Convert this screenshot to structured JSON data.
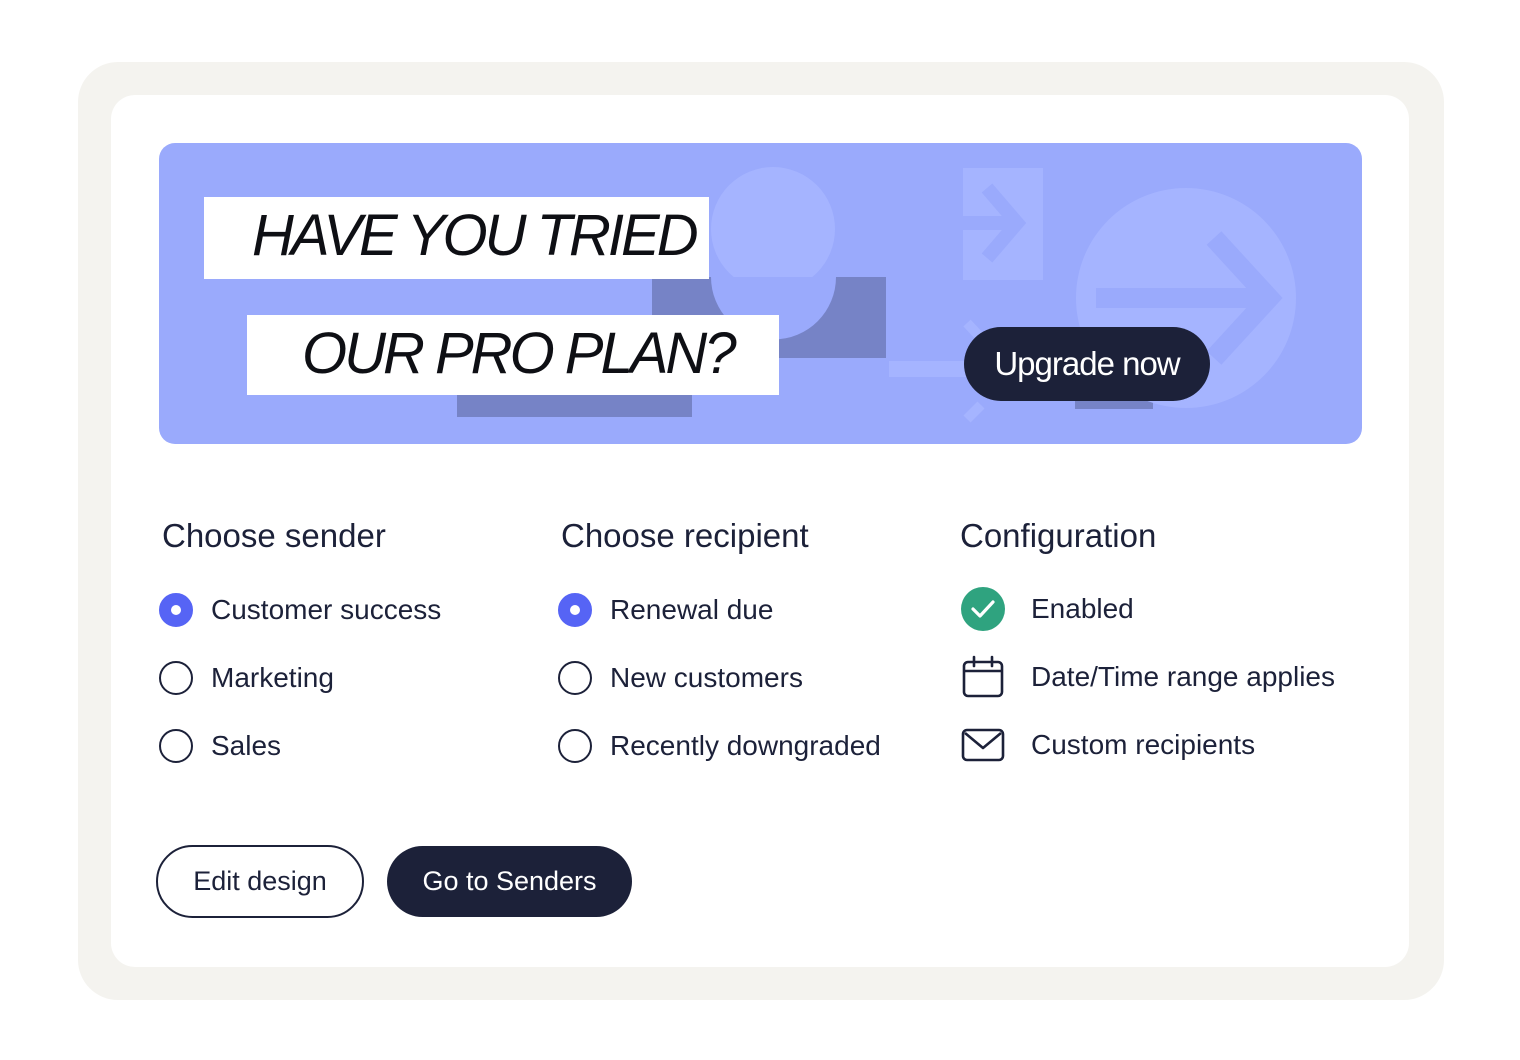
{
  "banner": {
    "headline_line1": "HAVE YOU TRIED",
    "headline_line2": "OUR PRO PLAN?",
    "cta_label": "Upgrade now"
  },
  "sender": {
    "heading": "Choose sender",
    "options": [
      {
        "label": "Customer success",
        "selected": true
      },
      {
        "label": "Marketing",
        "selected": false
      },
      {
        "label": "Sales",
        "selected": false
      }
    ]
  },
  "recipient": {
    "heading": "Choose recipient",
    "options": [
      {
        "label": "Renewal due",
        "selected": true
      },
      {
        "label": "New customers",
        "selected": false
      },
      {
        "label": "Recently downgraded",
        "selected": false
      }
    ]
  },
  "configuration": {
    "heading": "Configuration",
    "items": [
      {
        "label": "Enabled",
        "icon": "check-circle-icon"
      },
      {
        "label": "Date/Time range applies",
        "icon": "calendar-icon"
      },
      {
        "label": "Custom recipients",
        "icon": "mail-icon"
      }
    ]
  },
  "actions": {
    "edit_label": "Edit design",
    "go_label": "Go to Senders"
  },
  "colors": {
    "banner_bg": "#9aaafc",
    "dark": "#1c2139",
    "radio_selected": "#5664f5",
    "success": "#2fa37f",
    "outer_bg": "#f4f3ef"
  }
}
